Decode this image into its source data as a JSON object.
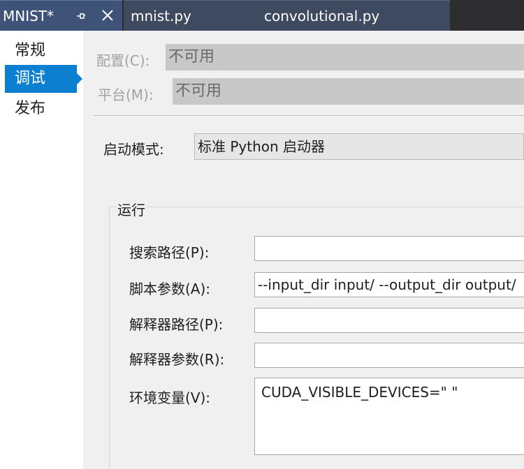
{
  "tabs": {
    "active": {
      "label": "MNIST*"
    },
    "others": [
      {
        "label": "mnist.py"
      },
      {
        "label": "convolutional.py"
      }
    ]
  },
  "sidebar": {
    "items": [
      {
        "label": "常规",
        "selected": false
      },
      {
        "label": "调试",
        "selected": true
      },
      {
        "label": "发布",
        "selected": false
      }
    ]
  },
  "config": {
    "configuration_label": "配置(C):",
    "configuration_value": "不可用",
    "platform_label": "平台(M):",
    "platform_value": "不可用"
  },
  "launch": {
    "label": "启动模式:",
    "value": "标准 Python 启动器"
  },
  "run": {
    "title": "运行",
    "fields": [
      {
        "label": "搜索路径(P):",
        "value": ""
      },
      {
        "label": "脚本参数(A):",
        "value": "--input_dir input/ --output_dir output/"
      },
      {
        "label": "解释器路径(P):",
        "value": ""
      },
      {
        "label": "解释器参数(R):",
        "value": ""
      },
      {
        "label": "环境变量(V):",
        "value": "CUDA_VISIBLE_DEVICES=\" \""
      }
    ]
  },
  "colors": {
    "accent": "#0d7fd1",
    "tab_active": "#3f5378",
    "tab_inactive": "#3e4a5f"
  }
}
